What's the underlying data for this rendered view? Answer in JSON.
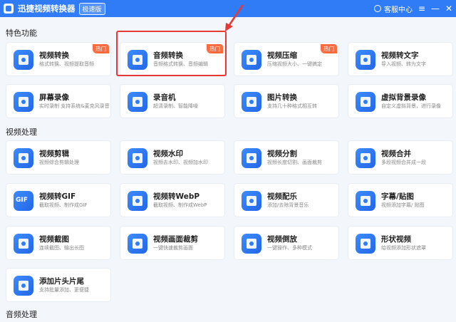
{
  "titlebar": {
    "app_title": "迅捷视频转换器",
    "edition_badge": "极速版",
    "service_label": "客服中心",
    "menu_glyph": "≡",
    "minimize_glyph": "—",
    "close_glyph": "✕"
  },
  "sections": {
    "featured": "特色功能",
    "video": "视频处理",
    "audio": "音频处理"
  },
  "hot_label": "热门",
  "cards": [
    {
      "title": "视频转换",
      "desc": "格式转换、视频提取音频",
      "icon": "video-convert-icon"
    },
    {
      "title": "音频转换",
      "desc": "音频格式转换、音频编辑",
      "icon": "audio-convert-icon"
    },
    {
      "title": "视频压缩",
      "desc": "压缩视频大小、一键搞定",
      "icon": "video-compress-icon"
    },
    {
      "title": "视频转文字",
      "desc": "导入视频、转为文字",
      "icon": "video-to-text-icon"
    },
    {
      "title": "屏幕录像",
      "desc": "实时录制 支持系统&麦克风录音",
      "icon": "screen-record-icon"
    },
    {
      "title": "录音机",
      "desc": "超清录制、智能降噪",
      "icon": "recorder-icon"
    },
    {
      "title": "图片转换",
      "desc": "支持几十种格式相互转",
      "icon": "image-convert-icon"
    },
    {
      "title": "虚拟背景录像",
      "desc": "自定义虚拟背景，进行录像",
      "icon": "virtual-background-icon"
    },
    {
      "title": "视频剪辑",
      "desc": "视频综合剪辑处理",
      "icon": "video-edit-icon"
    },
    {
      "title": "视频水印",
      "desc": "视频去水印、视频加水印",
      "icon": "video-watermark-icon"
    },
    {
      "title": "视频分割",
      "desc": "视频长度切割、画面裁剪",
      "icon": "video-split-icon"
    },
    {
      "title": "视频合并",
      "desc": "多段视频合并成一段",
      "icon": "video-merge-icon"
    },
    {
      "title": "视频转GIF",
      "desc": "截取视频、制作成GIF",
      "icon": "gif-icon"
    },
    {
      "title": "视频转WebP",
      "desc": "截取视频、制作成WebP",
      "icon": "webp-icon"
    },
    {
      "title": "视频配乐",
      "desc": "添加/去除背景音乐",
      "icon": "video-music-icon"
    },
    {
      "title": "字幕/贴图",
      "desc": "视频添加字幕/ 贴图",
      "icon": "subtitle-icon"
    },
    {
      "title": "视频截图",
      "desc": "连续截图、输出长图",
      "icon": "video-screenshot-icon"
    },
    {
      "title": "视频画面裁剪",
      "desc": "一键快速裁剪画面",
      "icon": "video-crop-icon"
    },
    {
      "title": "视频倒放",
      "desc": "一键操作、多种模式",
      "icon": "video-reverse-icon"
    },
    {
      "title": "形状视频",
      "desc": "给视频添加形状遮罩",
      "icon": "shape-video-icon"
    },
    {
      "title": "添加片头片尾",
      "desc": "支持批量添加、更便捷",
      "icon": "intro-outro-icon"
    }
  ],
  "colors": {
    "accent": "#2f7cf6",
    "hot": "#ff6a3d",
    "highlight": "#e53935"
  }
}
